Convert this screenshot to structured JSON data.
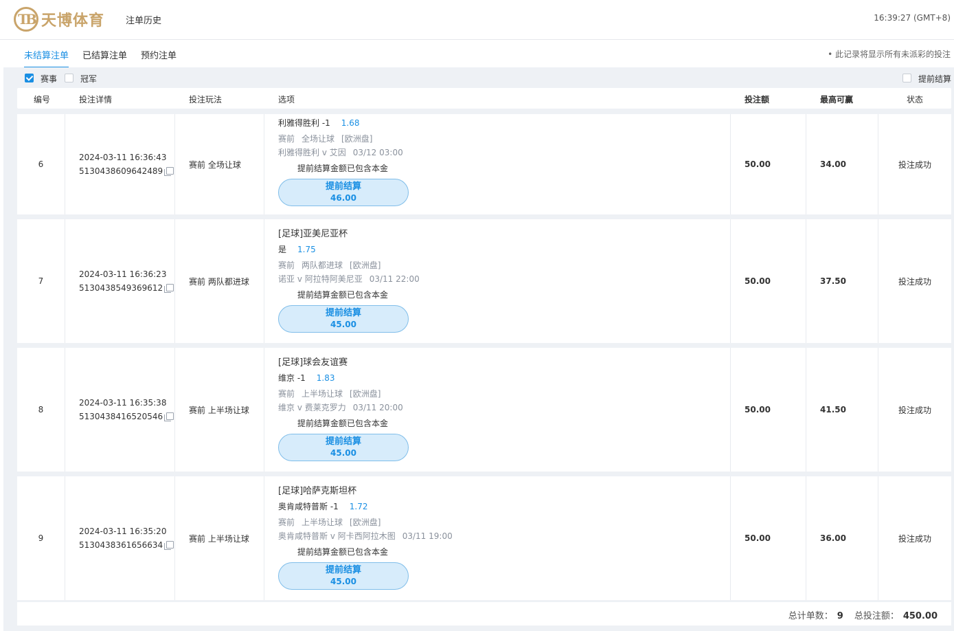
{
  "app": {
    "logo_text": "天博体育",
    "logo_mark": "TB",
    "nav_item": "注单历史",
    "clock": "16:39:27 (GMT+8)"
  },
  "tabs": [
    {
      "label": "未结算注单",
      "active": true
    },
    {
      "label": "已结算注单",
      "active": false
    },
    {
      "label": "预约注单",
      "active": false
    }
  ],
  "tabs_note": "• 此记录将显示所有未派彩的投注",
  "filters": {
    "events": {
      "label": "赛事",
      "checked": true
    },
    "outright": {
      "label": "冠军",
      "checked": false
    },
    "early_cashout": {
      "label": "提前结算",
      "checked": false
    }
  },
  "columns": {
    "id": "编号",
    "detail": "投注详情",
    "bet_type": "投注玩法",
    "selection": "选项",
    "stake": "投注额",
    "max_win": "最高可赢",
    "status": "状态"
  },
  "bets": [
    {
      "id": "6",
      "time": "2024-03-11 16:36:43",
      "ref": "5130438609642489",
      "bet_type": "赛前 全场让球",
      "league": "",
      "selection": "利雅得胜利 -1",
      "odds": "1.68",
      "market": "赛前",
      "market_type": "全场让球",
      "odds_format": "[欧洲盘]",
      "match": "利雅得胜利 v 艾因",
      "match_time": "03/12 03:00",
      "note": "提前结算金额已包含本金",
      "cashout_label": "提前结算",
      "cashout_value": "46.00",
      "stake": "50.00",
      "max_win": "34.00",
      "status": "投注成功"
    },
    {
      "id": "7",
      "time": "2024-03-11 16:36:23",
      "ref": "5130438549369612",
      "bet_type": "赛前 两队都进球",
      "league": "[足球]亚美尼亚杯",
      "selection": "是",
      "odds": "1.75",
      "market": "赛前",
      "market_type": "两队都进球",
      "odds_format": "[欧洲盘]",
      "match": "诺亚 v 阿拉特阿美尼亚",
      "match_time": "03/11 22:00",
      "note": "提前结算金额已包含本金",
      "cashout_label": "提前结算",
      "cashout_value": "45.00",
      "stake": "50.00",
      "max_win": "37.50",
      "status": "投注成功"
    },
    {
      "id": "8",
      "time": "2024-03-11 16:35:38",
      "ref": "5130438416520546",
      "bet_type": "赛前 上半场让球",
      "league": "[足球]球会友谊赛",
      "selection": "维京 -1",
      "odds": "1.83",
      "market": "赛前",
      "market_type": "上半场让球",
      "odds_format": "[欧洲盘]",
      "match": "维京 v 费莱克罗力",
      "match_time": "03/11 20:00",
      "note": "提前结算金额已包含本金",
      "cashout_label": "提前结算",
      "cashout_value": "45.00",
      "stake": "50.00",
      "max_win": "41.50",
      "status": "投注成功"
    },
    {
      "id": "9",
      "time": "2024-03-11 16:35:20",
      "ref": "5130438361656634",
      "bet_type": "赛前 上半场让球",
      "league": "[足球]哈萨克斯坦杯",
      "selection": "奥肯咸特普斯 -1",
      "odds": "1.72",
      "market": "赛前",
      "market_type": "上半场让球",
      "odds_format": "[欧洲盘]",
      "match": "奥肯咸特普斯 v 阿卡西阿拉木图",
      "match_time": "03/11 19:00",
      "note": "提前结算金额已包含本金",
      "cashout_label": "提前结算",
      "cashout_value": "45.00",
      "stake": "50.00",
      "max_win": "36.00",
      "status": "投注成功"
    }
  ],
  "footer": {
    "count_label": "总计单数：",
    "count": "9",
    "total_label": "总投注额：",
    "total": "450.00"
  },
  "colors": {
    "accent": "#1a8fe3",
    "logo_gold": "#c9a46a",
    "cashout_bg": "#d7ecfb"
  }
}
